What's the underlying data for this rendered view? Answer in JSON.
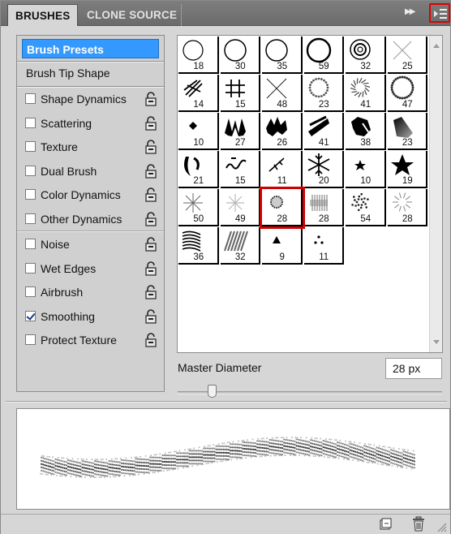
{
  "tabs": [
    {
      "label": "BRUSHES",
      "active": true
    },
    {
      "label": "CLONE SOURCE",
      "active": false
    }
  ],
  "panel_menu": {
    "icon": "panel-menu-icon",
    "highlight_color": "#e00000"
  },
  "collapse_icon": "double-arrow-icon",
  "options": {
    "presets_label": "Brush Presets",
    "tip_shape_label": "Brush Tip Shape",
    "items": [
      {
        "label": "Shape Dynamics",
        "checked": false,
        "lockable": true
      },
      {
        "label": "Scattering",
        "checked": false,
        "lockable": true
      },
      {
        "label": "Texture",
        "checked": false,
        "lockable": true
      },
      {
        "label": "Dual Brush",
        "checked": false,
        "lockable": true
      },
      {
        "label": "Color Dynamics",
        "checked": false,
        "lockable": true
      },
      {
        "label": "Other Dynamics",
        "checked": false,
        "lockable": true
      },
      {
        "label": "Noise",
        "checked": false,
        "lockable": true
      },
      {
        "label": "Wet Edges",
        "checked": false,
        "lockable": true
      },
      {
        "label": "Airbrush",
        "checked": false,
        "lockable": true
      },
      {
        "label": "Smoothing",
        "checked": true,
        "lockable": true
      },
      {
        "label": "Protect Texture",
        "checked": false,
        "lockable": true
      }
    ]
  },
  "presets": {
    "selected_index": 26,
    "items": [
      {
        "size": "18",
        "shape": "circle-hard-small"
      },
      {
        "size": "30",
        "shape": "circle-hard"
      },
      {
        "size": "35",
        "shape": "circle-hard"
      },
      {
        "size": "59",
        "shape": "circle-hard-large"
      },
      {
        "size": "32",
        "shape": "circle-concentric"
      },
      {
        "size": "25",
        "shape": "cross-thin"
      },
      {
        "size": "14",
        "shape": "hatch-diagonal"
      },
      {
        "size": "15",
        "shape": "hash"
      },
      {
        "size": "48",
        "shape": "cross-x"
      },
      {
        "size": "23",
        "shape": "dotted-ring"
      },
      {
        "size": "41",
        "shape": "spiral-dots"
      },
      {
        "size": "47",
        "shape": "dotted-ring-large"
      },
      {
        "size": "10",
        "shape": "diamond"
      },
      {
        "size": "27",
        "shape": "zigzag"
      },
      {
        "size": "26",
        "shape": "leaf-cluster"
      },
      {
        "size": "41",
        "shape": "chalk-stroke"
      },
      {
        "size": "38",
        "shape": "chalk-blot"
      },
      {
        "size": "23",
        "shape": "charcoal"
      },
      {
        "size": "21",
        "shape": "crescent"
      },
      {
        "size": "15",
        "shape": "squiggle"
      },
      {
        "size": "11",
        "shape": "twig"
      },
      {
        "size": "20",
        "shape": "snowflake"
      },
      {
        "size": "10",
        "shape": "star-small"
      },
      {
        "size": "19",
        "shape": "star"
      },
      {
        "size": "50",
        "shape": "starburst"
      },
      {
        "size": "49",
        "shape": "starburst-soft"
      },
      {
        "size": "28",
        "shape": "scatter-dots"
      },
      {
        "size": "28",
        "shape": "grass-blur"
      },
      {
        "size": "54",
        "shape": "scatter-flower"
      },
      {
        "size": "28",
        "shape": "scatter-sparse"
      },
      {
        "size": "36",
        "shape": "dune-lines"
      },
      {
        "size": "32",
        "shape": "grass-strokes"
      },
      {
        "size": "9",
        "shape": "triangle"
      },
      {
        "size": "11",
        "shape": "three-dots"
      }
    ]
  },
  "master_diameter": {
    "label": "Master Diameter",
    "value": "28 px",
    "slider_value": 28,
    "slider_max": 2500
  },
  "preview": {
    "icon": "stroke-preview"
  },
  "bottom": {
    "new_icon": "new-preset-icon",
    "trash_icon": "trash-icon",
    "grip_icon": "resize-grip-icon"
  }
}
